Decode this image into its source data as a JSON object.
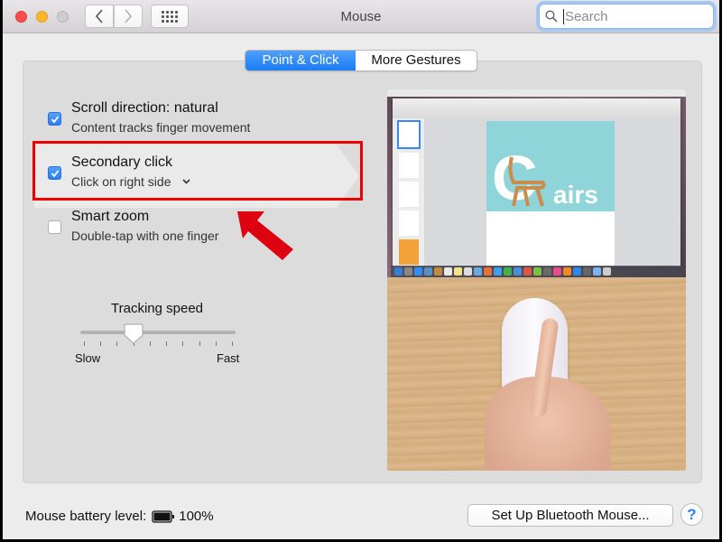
{
  "window": {
    "title": "Mouse",
    "search": {
      "placeholder": "Search",
      "value": ""
    }
  },
  "toolbar": {
    "back_icon": "chevron-left-icon",
    "forward_icon": "chevron-right-icon",
    "show_all_icon": "grid-icon"
  },
  "tabs": [
    {
      "label": "Point & Click",
      "active": true
    },
    {
      "label": "More Gestures",
      "active": false
    }
  ],
  "options": [
    {
      "title": "Scroll direction: natural",
      "subtitle": "Content tracks finger movement",
      "checked": true,
      "has_dropdown": false
    },
    {
      "title": "Secondary click",
      "subtitle": "Click on right side",
      "checked": true,
      "has_dropdown": true,
      "highlighted": true
    },
    {
      "title": "Smart zoom",
      "subtitle": "Double-tap with one finger",
      "checked": false,
      "has_dropdown": false
    }
  ],
  "tracking": {
    "label": "Tracking speed",
    "min_label": "Slow",
    "max_label": "Fast",
    "tick_count": 10,
    "value_fraction": 0.333
  },
  "preview": {
    "description": "Preview video: finger clicking right side of Magic Mouse with Pages app on screen",
    "doc_letter": "C",
    "doc_text": "airs"
  },
  "footer": {
    "battery_label": "Mouse battery level:",
    "battery_percent": "100%",
    "battery_level": 1.0,
    "setup_button": "Set Up Bluetooth Mouse...",
    "help_button": "?"
  },
  "annotations": {
    "highlight_color": "#ee0000",
    "accent_color": "#1a7cf5"
  }
}
